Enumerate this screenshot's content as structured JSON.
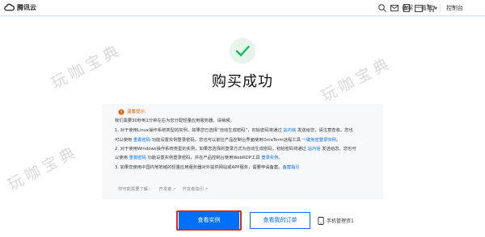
{
  "topbar": {
    "brand": "腾讯云",
    "nav": [
      "备案",
      "嘉钰",
      "控制台"
    ],
    "icons": [
      "search-icon",
      "message-icon",
      "document-icon",
      "calendar-icon",
      "cart-icon"
    ]
  },
  "success": {
    "title": "购买成功"
  },
  "notice": {
    "heading": "温馨提示:",
    "lines": [
      {
        "parts": [
          {
            "text": "我们需要30秒到1分钟左右为您分配轻量应用服务器，请稍候。"
          }
        ]
      },
      {
        "parts": [
          {
            "text": "1. 对于使用Linux操作系统类型的实例，如果您已选择“自动生成密码”，初始密码将通过 "
          },
          {
            "text": "站内信",
            "link": true
          },
          {
            "text": " 发送给您，请注意查收。您也"
          }
        ]
      },
      {
        "parts": [
          {
            "text": "可以使用 "
          },
          {
            "text": "重置密码",
            "link": true
          },
          {
            "text": " 功能设置实例登录密码。您也可以前往产品控制台界面使用OrcaTerm远程工具 "
          },
          {
            "text": "一键免密登录实例",
            "link": true
          },
          {
            "text": "。"
          }
        ]
      },
      {
        "parts": [
          {
            "text": "2. 对于使用Windows操作系统类型的实例，如果您选择的登录方式为自动生成密码，初始密码将通过 "
          },
          {
            "text": "站内信",
            "link": true
          },
          {
            "text": " 发送给您。您也可"
          }
        ]
      },
      {
        "parts": [
          {
            "text": "以使用 "
          },
          {
            "text": "重置密码",
            "link": true
          },
          {
            "text": " 功能设置实例登录密码，并在产品控制台使用WebRDP工具 "
          },
          {
            "text": "登录实例",
            "link": true
          },
          {
            "text": "。"
          }
        ]
      },
      {
        "parts": [
          {
            "text": "3. 如果您使用中国内地地域的轻量应用服务器对外提供网站或APP服务，需要申请备案。"
          },
          {
            "text": "备案指引",
            "link": true
          }
        ]
      }
    ],
    "help_label": "你可能需要了解：",
    "help_links": [
      "开发者",
      "开发者指引"
    ]
  },
  "actions": {
    "view_instance": "查看实例",
    "view_orders": "查看我的订单",
    "mobile_mgmt": "手机管理资1"
  },
  "watermark": "玩咖宝典",
  "colors": {
    "accent": "#006eff",
    "success": "#0abf5b",
    "warning": "#e35f00",
    "highlight": "#e02424"
  }
}
